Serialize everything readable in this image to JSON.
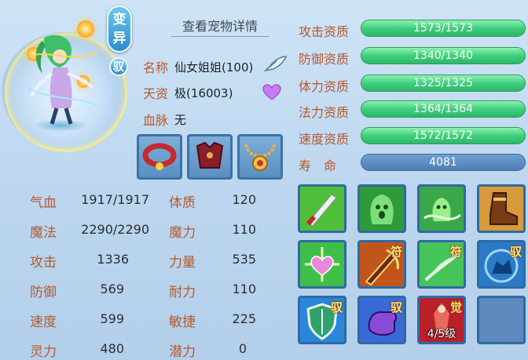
{
  "header": {
    "transform_label_line1": "变",
    "transform_label_line2": "异",
    "mount_label": "驭",
    "detail_title": "查看宠物详情"
  },
  "info": {
    "name_label": "名称",
    "name_value": "仙女姐姐(100)",
    "talent_label": "天资",
    "talent_value": "极(16003)",
    "bloodline_label": "血脉",
    "bloodline_value": "无"
  },
  "equipment": [
    {
      "icon": "red-collar-icon"
    },
    {
      "icon": "red-armor-icon"
    },
    {
      "icon": "gold-necklace-icon"
    }
  ],
  "stats": [
    {
      "label": "气血",
      "value": "1917/1917"
    },
    {
      "label": "魔法",
      "value": "2290/2290"
    },
    {
      "label": "攻击",
      "value": "1336"
    },
    {
      "label": "防御",
      "value": "569"
    },
    {
      "label": "速度",
      "value": "599"
    },
    {
      "label": "灵力",
      "value": "480"
    }
  ],
  "attributes": [
    {
      "label": "体质",
      "value": "120"
    },
    {
      "label": "魔力",
      "value": "110"
    },
    {
      "label": "力量",
      "value": "535"
    },
    {
      "label": "耐力",
      "value": "110"
    },
    {
      "label": "敏捷",
      "value": "225"
    },
    {
      "label": "潜力",
      "value": "0"
    }
  ],
  "aptitudes": [
    {
      "label": "攻击资质",
      "value": "1573/1573"
    },
    {
      "label": "防御资质",
      "value": "1340/1340"
    },
    {
      "label": "体力资质",
      "value": "1325/1325"
    },
    {
      "label": "法力资质",
      "value": "1364/1364"
    },
    {
      "label": "速度资质",
      "value": "1572/1572"
    }
  ],
  "lifespan": {
    "label": "寿　命",
    "value": "4081"
  },
  "skills": [
    {
      "icon": "sword-strike-icon",
      "tag": ""
    },
    {
      "icon": "green-ghost-icon",
      "tag": ""
    },
    {
      "icon": "green-ghost-wind-icon",
      "tag": ""
    },
    {
      "icon": "boot-icon",
      "tag": ""
    },
    {
      "icon": "heart-light-icon",
      "tag": ""
    },
    {
      "icon": "fire-sword-icon",
      "tag": "符"
    },
    {
      "icon": "green-feather-icon",
      "tag": "符"
    },
    {
      "icon": "blue-beast-icon",
      "tag": "驭"
    },
    {
      "icon": "shield-icon",
      "tag": "驭"
    },
    {
      "icon": "purple-fist-icon",
      "tag": "驭"
    },
    {
      "icon": "awaken-warrior-icon",
      "tag": "觉",
      "level": "4/5级"
    },
    {
      "icon": "empty-slot-icon",
      "tag": ""
    }
  ]
}
